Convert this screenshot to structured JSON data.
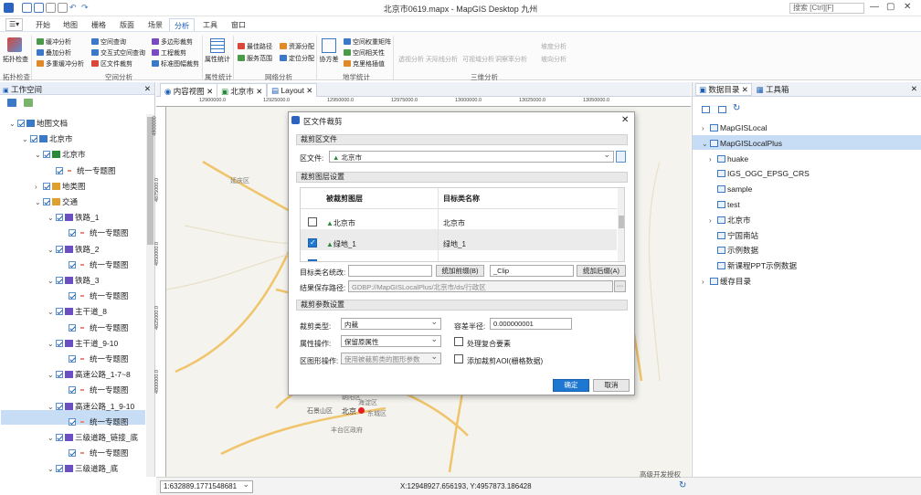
{
  "title": "北京市0619.mapx - MapGIS Desktop 九州",
  "search_placeholder": "搜索  [Ctrl][F]",
  "menu_tabs": [
    "开始",
    "地图",
    "栅格",
    "版面",
    "场景",
    "分析",
    "工具",
    "窗口"
  ],
  "ribbon": {
    "topo_check": "拓扑检查",
    "col1": [
      "缓冲分析",
      "叠加分析",
      "多重缓冲分析"
    ],
    "col2": [
      "空间查询",
      "交互式空间查询",
      "区文件裁剪"
    ],
    "col3": [
      "多边形裁剪",
      "工程裁剪",
      "标准图幅裁剪"
    ],
    "attr_stats": "属性统计",
    "net1": [
      "最佳路径",
      "服务范围"
    ],
    "net2": [
      "资源分配",
      "定位分配"
    ],
    "cov": "协方差",
    "geostat": [
      "空间权重矩阵",
      "空间相关性",
      "克里格插值"
    ],
    "threed": [
      "透视分析",
      "天际线分析",
      "可视域分析",
      "洞察率分析",
      "坡度分析",
      "坡向分析"
    ],
    "groups": [
      "拓扑检查",
      "空间分析",
      "属性统计",
      "网络分析",
      "地学统计",
      "三维分析"
    ]
  },
  "left_panel": {
    "title": "工作空间",
    "tree": [
      "地图文档",
      "北京市",
      "北京市",
      "统一专题图",
      "地类图",
      "交通",
      "铁路_1",
      "统一专题图",
      "铁路_2",
      "统一专题图",
      "铁路_3",
      "统一专题图",
      "主干道_8",
      "统一专题图",
      "主干道_9-10",
      "统一专题图",
      "高速公路_1-7~8",
      "统一专题图",
      "高速公路_1_9-10",
      "统一专题图",
      "三级道路_链接_底",
      "统一专题图",
      "三级道路_底",
      "统一专题图"
    ]
  },
  "doc_tabs": [
    "内容视图",
    "北京市",
    "Layout"
  ],
  "ruler_labels": [
    "12900000.0",
    "12925000.0",
    "12950000.0",
    "12975000.0",
    "13000000.0",
    "13025000.0",
    "13050000.0"
  ],
  "ruler_v_labels": [
    "4900000",
    "4875000.0",
    "4850000.0",
    "4825000.0",
    "4800000.0"
  ],
  "map_labels": [
    "延庆区",
    "昌平区",
    "海淀区",
    "北京",
    "石景山区",
    "东城区",
    "朝阳区",
    "丰台区政府"
  ],
  "right_panel": {
    "tabs": [
      "数据目录",
      "工具箱"
    ],
    "items": [
      "MapGISLocal",
      "MapGISLocalPlus",
      "huake",
      "IGS_OGC_EPSG_CRS",
      "sample",
      "test",
      "北京市",
      "宁国南站",
      "示例数据",
      "新课程PPT示例数据",
      "缓存目录"
    ]
  },
  "dialog": {
    "title": "区文件裁剪",
    "sec1": "裁剪区文件",
    "region_label": "区文件:",
    "region_value": "北京市",
    "sec2": "裁剪图层设置",
    "col_layer": "被裁剪图层",
    "col_target": "目标类名称",
    "rows": [
      {
        "layer": "北京市",
        "target": "北京市",
        "checked": false
      },
      {
        "layer": "绿地_1",
        "target": "绿地_1",
        "checked": true
      },
      {
        "layer": "绿地_2",
        "target": "绿地_2",
        "checked": true
      }
    ],
    "rename_label": "目标类名统改:",
    "prefix_btn": "统加前缀(B)",
    "suffix_value": "_Clip",
    "suffix_btn": "统加后缀(A)",
    "save_label": "结果保存路径:",
    "save_value": "GDBP://MapGISLocalPlus/北京市/ds/行政区",
    "sec3": "裁剪参数设置",
    "cliptype_label": "裁剪类型:",
    "cliptype_value": "内裁",
    "tol_label": "容差半径:",
    "tol_value": "0.000000001",
    "attr_label": "属性操作:",
    "attr_value": "保留原属性",
    "complex_label": "处理复合要素",
    "shape_label": "区图形操作:",
    "shape_value": "使用被裁剪类的图形参数",
    "aoi_label": "添加裁剪AOI(栅格数据)",
    "ok": "确定",
    "cancel": "取消"
  },
  "status": {
    "scale": "1:632889.1771548681",
    "coords": "X:12948927.656193, Y:4957873.186428",
    "license": "高级开发授权"
  },
  "colors": {
    "accent": "#1a5fb4",
    "ok": "#1e78d2"
  }
}
